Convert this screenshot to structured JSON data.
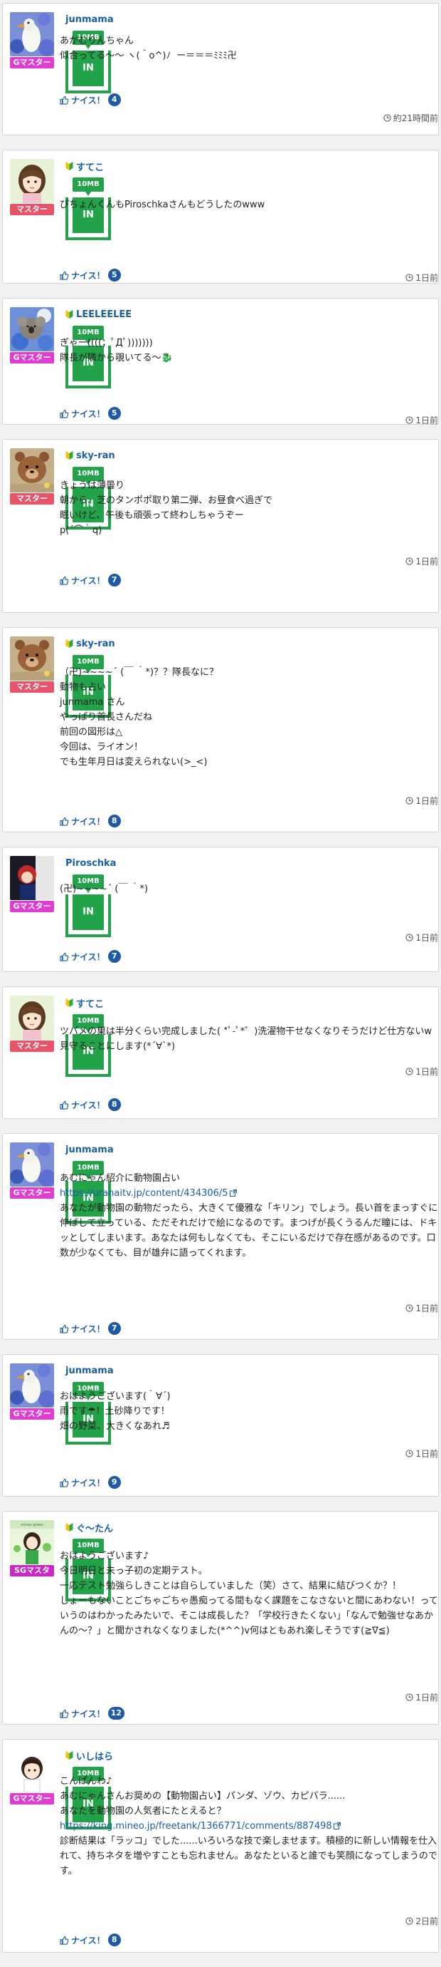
{
  "colors": {
    "g_master": "#e03cd2",
    "master": "#e8536a",
    "sg_master": "#cc28c5",
    "in_green": "#22a34a",
    "link_blue": "#1a5ea8",
    "count_blue": "#1f5aa6"
  },
  "share_widget": {
    "mb_label": "10MB",
    "in_label": "IN"
  },
  "nice_label": "ナイス！",
  "posts": [
    {
      "user": "junmama",
      "beginner": false,
      "rank": "Gマスター",
      "rank_type": "g_master",
      "avatar": "penguin-photo",
      "text": "あかむりんちゃん\n似合ってる〜〜 ヽ(＾o^)ﾉ  ー＝＝＝ﾐﾐﾐ卍",
      "time": "約21時間前",
      "nice": "4"
    },
    {
      "user": "すてこ",
      "beginner": true,
      "rank": "マスター",
      "rank_type": "master",
      "avatar": "girl-illustration",
      "text": "ぴちょんくんもPiroschkaさんもどうしたのwww",
      "time": "1日前",
      "nice": "5"
    },
    {
      "user": "LEELEELEE",
      "beginner": true,
      "rank": "Gマスター",
      "rank_type": "g_master",
      "avatar": "koala-photo",
      "text": "ぎゃー((((；ﾟДﾟ)))))))\n隊長が隣から覗いてる〜🐉",
      "time": "1日前",
      "nice": "5"
    },
    {
      "user": "sky-ran",
      "beginner": true,
      "rank": "マスター",
      "rank_type": "master",
      "avatar": "bear-photo",
      "text": "きょうは薄曇り\n朝から、芝のタンポポ取り第二弾、お昼食べ過ぎで\n眠いけど、午後も頑張って終わしちゃうぞー\np(´⌒｀q)",
      "time": "1日前",
      "nice": "7"
    },
    {
      "user": "sky-ran",
      "beginner": true,
      "rank": "マスター",
      "rank_type": "master",
      "avatar": "bear-photo",
      "text": "（卍)~~~~´ (￣ ｀*)？？隊長なに？\n動物も占い\njunmama さん\nやっぱり首長さんだね\n前回の図形は△\n今回は、ライオン！\nでも生年月日は変えられない(>_<)",
      "time": "1日前",
      "nice": "8"
    },
    {
      "user": "Piroschka",
      "beginner": false,
      "rank": "Gマスター",
      "rank_type": "g_master",
      "avatar": "character-photo",
      "text": "(卍)~~~~´ (￣ ｀*)",
      "time": "1日前",
      "nice": "7"
    },
    {
      "user": "すてこ",
      "beginner": true,
      "rank": "マスター",
      "rank_type": "master",
      "avatar": "girl-illustration",
      "text": "ツバメの巣は半分くらい完成しました( *ﾟ-ﾟ*゜)洗濯物干せなくなりそうだけど仕方ないw見守ることにします(*´∀`*)",
      "time": "1日前",
      "nice": "8"
    },
    {
      "user": "junmama",
      "beginner": false,
      "rank": "Gマスター",
      "rank_type": "g_master",
      "avatar": "penguin-photo",
      "text": "あむにゃん紹介に動物園占い\n",
      "link": "https://uranaitv.jp/content/434306/5",
      "text_after": "\nあなたが動物園の動物だったら、大きくて優雅な「キリン」でしょう。長い首をまっすぐに伸ばして立っている、ただそれだけで絵になるのです。まつげが長くうるんだ瞳には、ドキッとしてしまいます。あなたは何もしなくても、そこにいるだけで存在感があるのです。口数が少なくても、目が雄弁に語ってくれます。",
      "time": "1日前",
      "nice": "7"
    },
    {
      "user": "junmama",
      "beginner": false,
      "rank": "Gマスター",
      "rank_type": "g_master",
      "avatar": "penguin-photo",
      "text": "おはようございます(｀∀´)\n雨です☂！土砂降りです！\n畑の野菜、大きくなあれ♬",
      "time": "1日前",
      "nice": "9"
    },
    {
      "user": "ぐ〜たん",
      "beginner": true,
      "rank": "SGマスタ",
      "rank_type": "sg_master",
      "avatar": "mineo-girl",
      "text": "おはようございます♪\n今日明日と未っ子初の定期テスト。\n一応テスト勉強らしきことは自らしていました（笑）さて、結果に結びつくか？！\nしょーもないことごちゃごちゃ愚痴ってる間もなく課題をこなさないと間にあわない！っていうのはわかったみたいで、そこは成長した？「学校行きたくない」「なんで勉強せなあかんの〜？」と聞かされなくなりました(*^^)v何はともあれ楽しそうです(≧∇≦)",
      "time": "1日前",
      "nice": "12"
    },
    {
      "user": "いしはら",
      "beginner": true,
      "rank": "Gマスター",
      "rank_type": "g_master",
      "avatar": "boy-illustration",
      "text": "こんばんわ♪\nあむにゃんさんお奨めの【動物園占い】パンダ、ゾウ、カピバラ......\nあなたを動物園の人気者にたとえると？\n",
      "link": "https://king.mineo.jp/freetank/1366771/comments/887498",
      "text_after": "\n診断結果は「ラッコ」でした......いろいろな技で楽しませます。積極的に新しい情報を仕入れて、持ちネタを増やすことも忘れません。あなたといると誰でも笑顔になってしまうのです。",
      "time": "2日前",
      "nice": "8"
    }
  ]
}
